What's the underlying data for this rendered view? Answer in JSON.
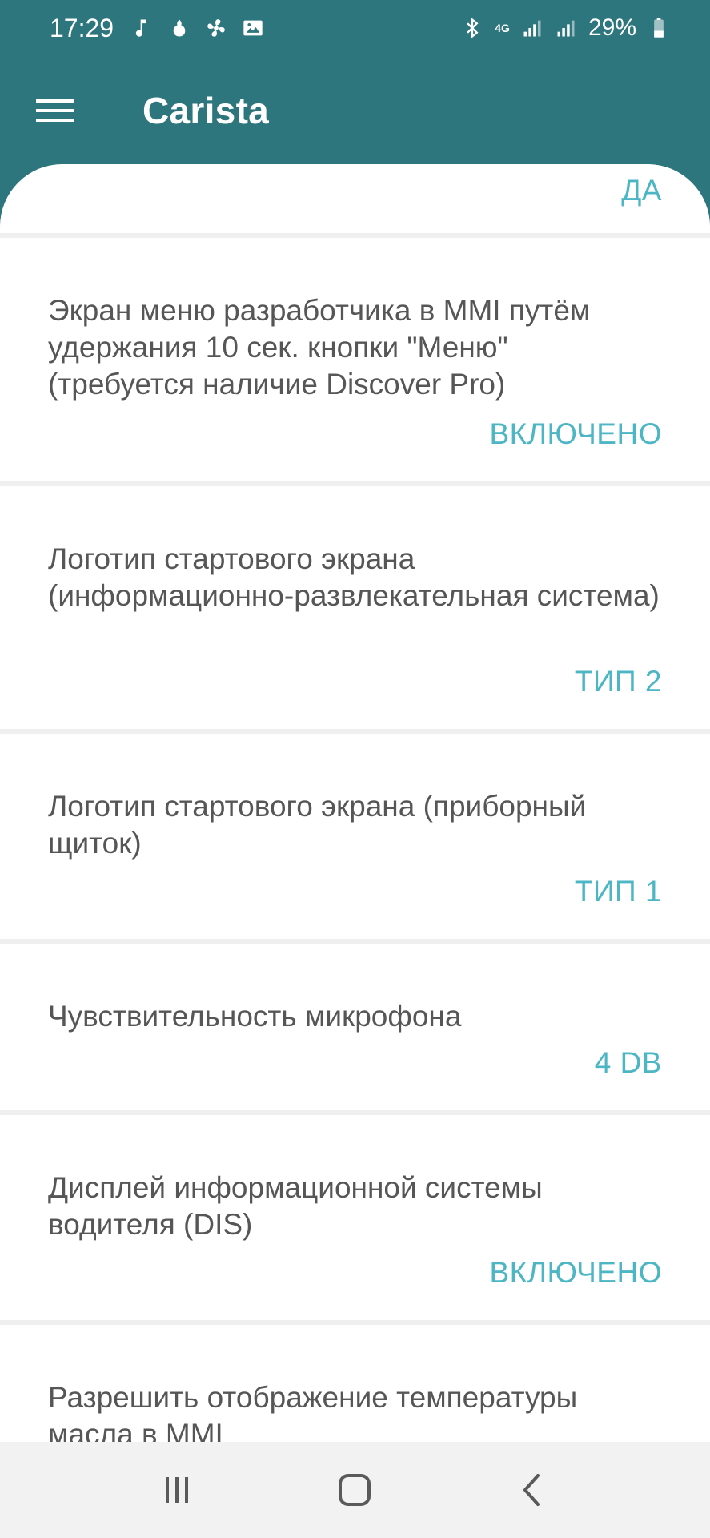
{
  "status_bar": {
    "time": "17:29",
    "battery": "29%",
    "network": "4G"
  },
  "app_bar": {
    "title": "Carista"
  },
  "settings": [
    {
      "label": "",
      "value": "ДА"
    },
    {
      "label": "Экран меню разработчика в MMI путём удержания 10 сек. кнопки \"Меню\" (требуется наличие Discover Pro)",
      "value": "ВКЛЮЧЕНО"
    },
    {
      "label": "Логотип стартового экрана (информационно-развлекательная система)",
      "value": "ТИП 2"
    },
    {
      "label": "Логотип стартового экрана (приборный щиток)",
      "value": "ТИП 1"
    },
    {
      "label": "Чувствительность микрофона",
      "value": "4 DB"
    },
    {
      "label": "Дисплей информационной системы водителя (DIS)",
      "value": "ВКЛЮЧЕНО"
    },
    {
      "label": "Разрешить отображение температуры масла в MMI",
      "value": ""
    }
  ],
  "colors": {
    "app_bar": "#2e767d",
    "accent_value": "#4cb6c4",
    "label_text": "#565656"
  },
  "icons": {
    "menu": "hamburger-menu-icon",
    "nav_recent": "recent-apps-icon",
    "nav_home": "home-icon",
    "nav_back": "back-icon"
  }
}
